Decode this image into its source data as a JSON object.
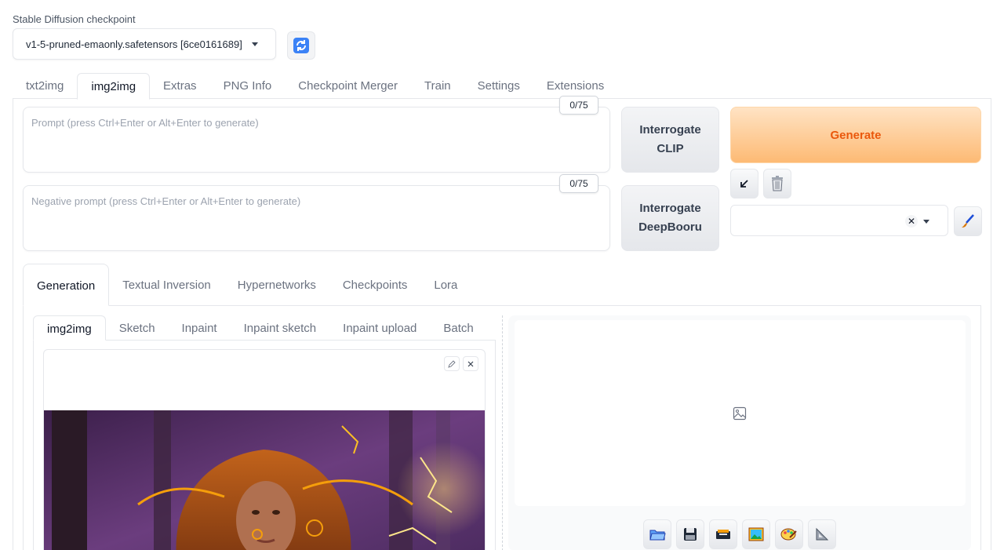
{
  "checkpoint": {
    "label": "Stable Diffusion checkpoint",
    "value": "v1-5-pruned-emaonly.safetensors [6ce0161689]"
  },
  "top_tabs": [
    {
      "label": "txt2img",
      "active": false
    },
    {
      "label": "img2img",
      "active": true
    },
    {
      "label": "Extras",
      "active": false
    },
    {
      "label": "PNG Info",
      "active": false
    },
    {
      "label": "Checkpoint Merger",
      "active": false
    },
    {
      "label": "Train",
      "active": false
    },
    {
      "label": "Settings",
      "active": false
    },
    {
      "label": "Extensions",
      "active": false
    }
  ],
  "prompt": {
    "placeholder": "Prompt (press Ctrl+Enter or Alt+Enter to generate)",
    "counter": "0/75"
  },
  "negative_prompt": {
    "placeholder": "Negative prompt (press Ctrl+Enter or Alt+Enter to generate)",
    "counter": "0/75"
  },
  "buttons": {
    "interrogate_clip": "Interrogate CLIP",
    "interrogate_deepbooru": "Interrogate DeepBooru",
    "generate": "Generate"
  },
  "gen_tabs": [
    {
      "label": "Generation",
      "active": true
    },
    {
      "label": "Textual Inversion",
      "active": false
    },
    {
      "label": "Hypernetworks",
      "active": false
    },
    {
      "label": "Checkpoints",
      "active": false
    },
    {
      "label": "Lora",
      "active": false
    }
  ],
  "sub_tabs": [
    {
      "label": "img2img",
      "active": true
    },
    {
      "label": "Sketch",
      "active": false
    },
    {
      "label": "Inpaint",
      "active": false
    },
    {
      "label": "Inpaint sketch",
      "active": false
    },
    {
      "label": "Inpaint upload",
      "active": false
    },
    {
      "label": "Batch",
      "active": false
    }
  ],
  "icons": {
    "refresh": "refresh-icon",
    "arrow": "arrow-down-left-icon",
    "trash": "trash-icon",
    "paint": "paintbrush-icon",
    "edit": "pencil-icon",
    "close": "close-icon",
    "image_placeholder": "image-placeholder-icon",
    "output_buttons": [
      "folder-icon",
      "save-icon",
      "zip-icon",
      "send-to-img2img-icon",
      "send-to-inpaint-icon",
      "send-to-extras-icon"
    ]
  },
  "colors": {
    "generate_text": "#ea580c",
    "generate_bg": "#fdba74"
  }
}
